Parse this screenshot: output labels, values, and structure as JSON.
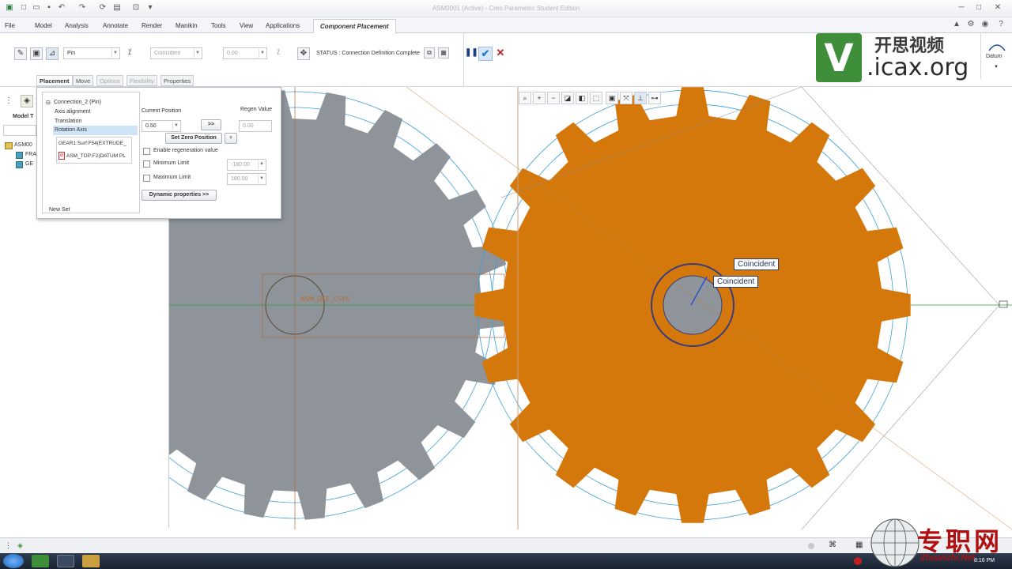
{
  "window": {
    "title": "ASM0001 (Active) - Creo Parametric Student Edition"
  },
  "ribbon_tabs": [
    "File",
    "Model",
    "Analysis",
    "Annotate",
    "Render",
    "Manikin",
    "Tools",
    "View",
    "Applications",
    "Component Placement"
  ],
  "ribbon": {
    "constraint_type": "Pin",
    "constraint_sub": "Coincident",
    "offset_value": "0.00",
    "status_text": "STATUS : Connection Definition Complete"
  },
  "subtabs": [
    "Placement",
    "Move",
    "Options",
    "Flexibility",
    "Properties"
  ],
  "tree": {
    "title": "Model T",
    "items": [
      "ASM00",
      "FRA",
      "GE"
    ]
  },
  "placement": {
    "connection": "Connection_2 (Pin)",
    "items": [
      "Axis alignment",
      "Translation",
      "Rotation Axis"
    ],
    "ref1": "GEAR1:Surf:F54(EXTRUDE_",
    "ref2": "ASM_TOP:F2(DATUM PL",
    "new_set": "New Set",
    "current_position_label": "Current Position",
    "current_position_value": "0.50",
    "arrow_btn": ">>",
    "regen_label": "Regen Value",
    "regen_value": "0.00",
    "set_zero": "Set Zero Position",
    "enable_regen": "Enable regeneration value",
    "min_label": "Minimum Limit",
    "min_value": "-180.00",
    "max_label": "Maximum Limit",
    "max_value": "180.00",
    "dynamic": "Dynamic properties >>"
  },
  "datum_label": "Datum",
  "callouts": [
    "Coincident",
    "Coincident"
  ],
  "asm_label": "ASM_DEF_CSYS",
  "logo": {
    "main": "开思视频",
    "url": ".icax.org",
    "letter": "V"
  },
  "watermark": {
    "cn": "专职网",
    "url": "Zhuanzhi.Net"
  },
  "clock": "8:16 PM",
  "colors": {
    "orange_gear": "#d4780c",
    "gray_gear": "#8e9499",
    "accent": "#2a7fd1"
  }
}
